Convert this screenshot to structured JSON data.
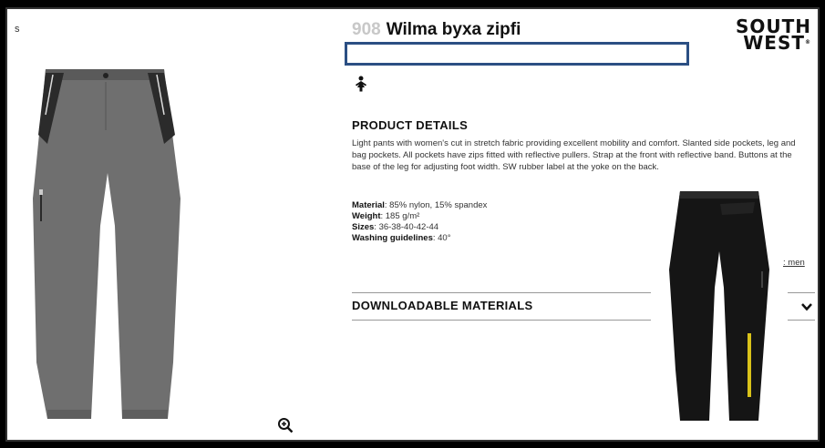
{
  "edge_mark": "s",
  "product": {
    "number": "908",
    "name": "Wilma byxa zipfi"
  },
  "brand": {
    "line1": "SOUTH",
    "line2": "WEST",
    "mark": "®"
  },
  "details": {
    "heading": "PRODUCT DETAILS",
    "description": "Light pants with women's cut in stretch fabric providing excellent mobility and comfort. Slanted side pockets, leg and bag pockets. All pockets have zips fitted with reflective pullers. Strap at the front with reflective band. Buttons at the base of the leg for adjusting foot width. SW rubber label at the yoke on the back.",
    "specs": [
      {
        "label": "Material",
        "value": ": 85% nylon, 15% spandex"
      },
      {
        "label": "Weight",
        "value": ": 185 g/m²"
      },
      {
        "label": "Sizes",
        "value": ": 36-38-40-42-44"
      },
      {
        "label": "Washing guidelines",
        "value": ": 40°"
      }
    ]
  },
  "related_link": ": men",
  "downloads": {
    "heading": "DOWNLOADABLE MATERIALS"
  },
  "icons": {
    "zoom": "zoom-in-icon",
    "gender": "female-icon",
    "expand": "chevron-down-icon"
  },
  "colors": {
    "highlight_border": "#2b4f83",
    "pants_grey": "#6f6f6f",
    "pants_black": "#151515",
    "accent_yellow": "#d9c21a"
  }
}
